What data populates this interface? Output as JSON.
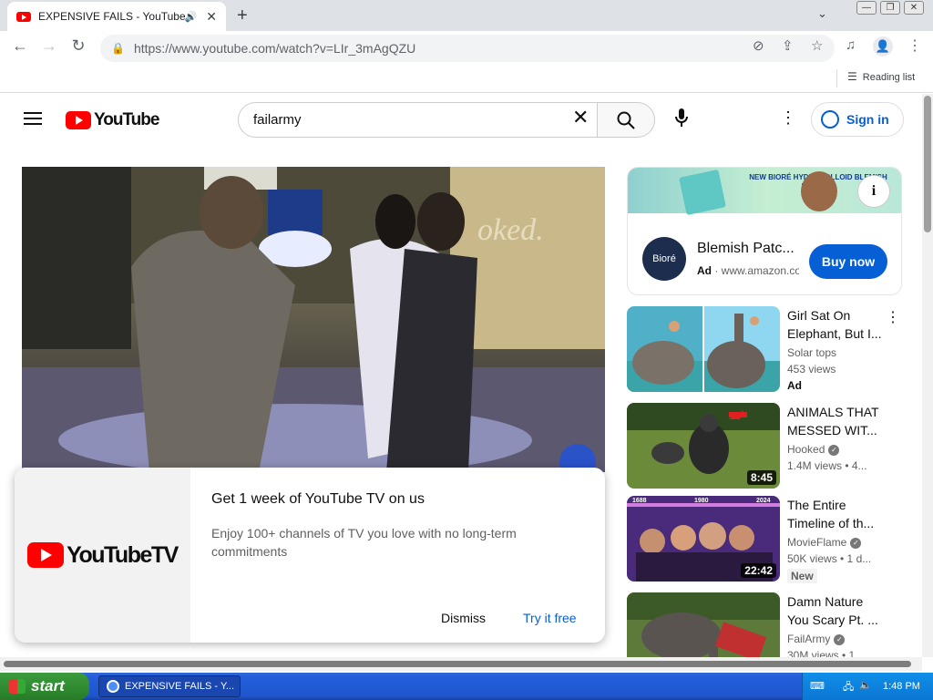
{
  "browser": {
    "tab_title": "EXPENSIVE FAILS - YouTube",
    "url": "https://www.youtube.com/watch?v=LIr_3mAgQZU",
    "reading_list": "Reading list",
    "new_tab": "+",
    "tab_close": "✕"
  },
  "youtube": {
    "logo_text": "YouTube",
    "search_value": "failarmy",
    "sign_in": "Sign in"
  },
  "popup": {
    "logo_text": "YouTubeTV",
    "heading": "Get 1 week of YouTube TV on us",
    "description": "Enjoy 100+ channels of TV you love with no long-term commitments",
    "dismiss": "Dismiss",
    "try_free": "Try it free"
  },
  "ad": {
    "banner_text": "NEW BIORÉ HYDROCOLLOID BLEMISH PATCHES",
    "avatar_text": "Bioré",
    "title": "Blemish Patc...",
    "ad_label": "Ad",
    "domain": "www.amazon.co",
    "cta": "Buy now"
  },
  "recommendations": [
    {
      "title": "Girl Sat On Elephant, But I...",
      "channel": "Solar tops",
      "views": "453 views",
      "tag": "Ad",
      "duration": "",
      "verified": false
    },
    {
      "title": "ANIMALS THAT MESSED WIT...",
      "channel": "Hooked",
      "views": "1.4M views  • 4...",
      "tag": "",
      "duration": "8:45",
      "verified": true
    },
    {
      "title": "The Entire Timeline of th...",
      "channel": "MovieFlame",
      "views": "50K views  • 1 d...",
      "tag": "New",
      "duration": "22:42",
      "verified": true
    },
    {
      "title": "Damn Nature You Scary Pt. ...",
      "channel": "FailArmy",
      "views": "30M views  • 1...",
      "tag": "",
      "duration": "",
      "verified": true
    }
  ],
  "thumb3_years": [
    "1688",
    "1980",
    "2024"
  ],
  "taskbar": {
    "start": "start",
    "task_item": "EXPENSIVE FAILS - Y...",
    "clock": "1:48 PM"
  },
  "colors": {
    "youtube_red": "#ff0000",
    "link_blue": "#065fd4",
    "xp_blue": "#245edb",
    "start_green": "#3c9a3c"
  }
}
